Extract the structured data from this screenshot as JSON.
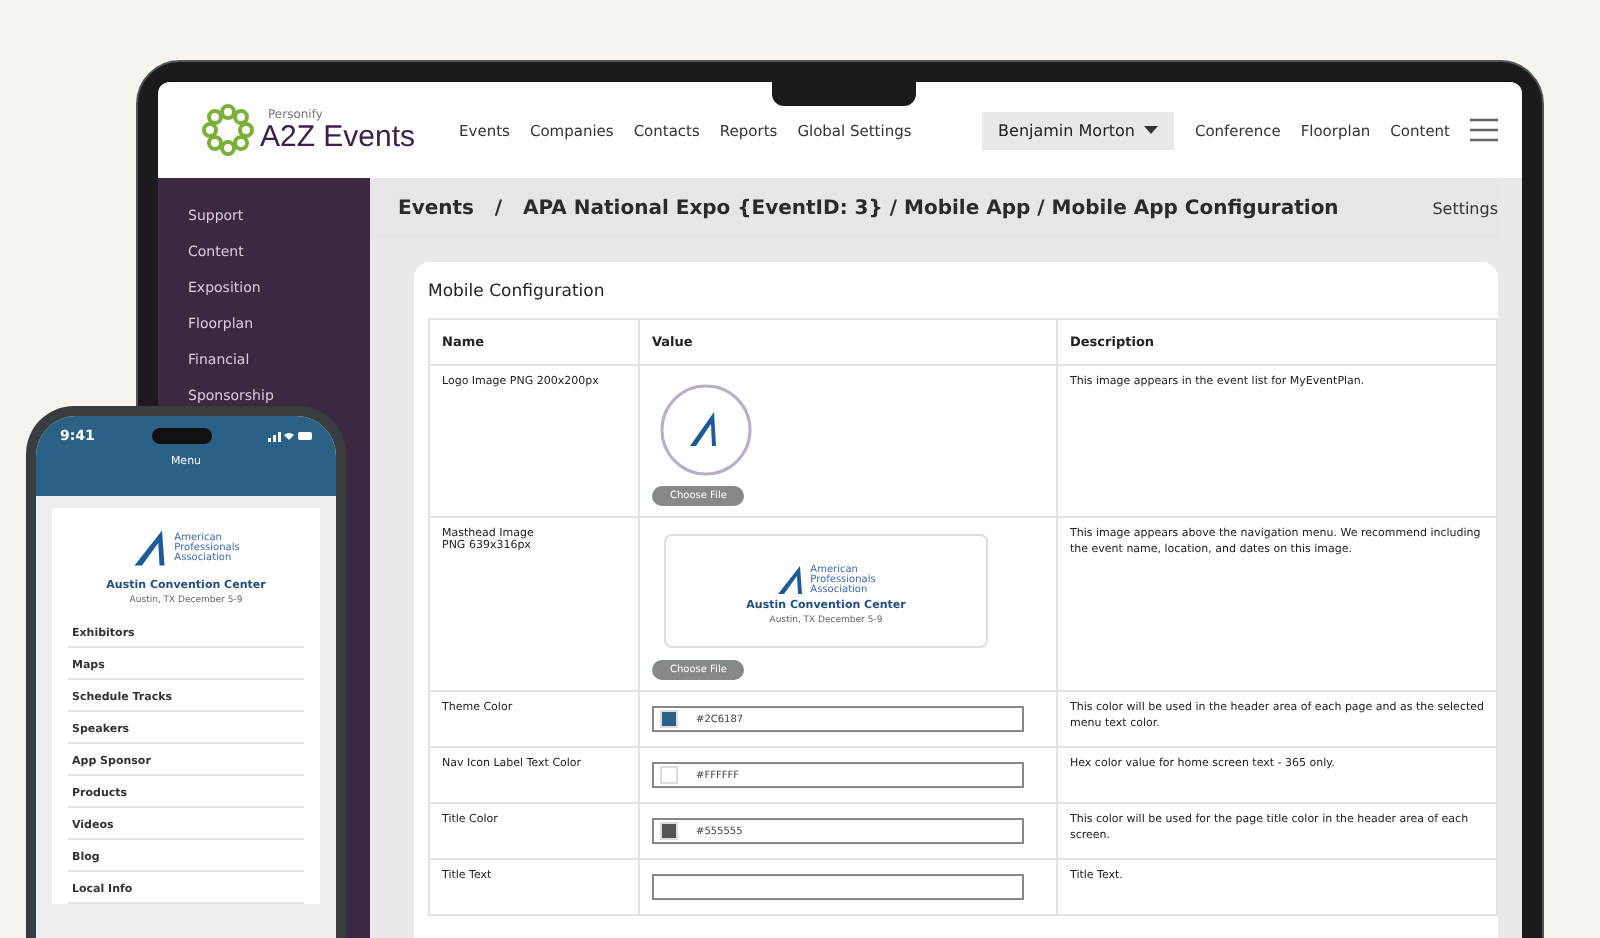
{
  "brand": {
    "small": "Personify",
    "name": "A2Z Events"
  },
  "nav": [
    "Events",
    "Companies",
    "Contacts",
    "Reports",
    "Global Settings"
  ],
  "user_menu": "Benjamin Morton",
  "nav_right": [
    "Conference",
    "Floorplan",
    "Content"
  ],
  "sidebar": {
    "items": [
      "Support",
      "Content",
      "Exposition",
      "Floorplan",
      "Financial",
      "Sponsorship"
    ]
  },
  "breadcrumb": {
    "text": "Events   /   APA National Expo {EventID: 3} / Mobile App / Mobile App Configuration",
    "action": "Settings"
  },
  "card": {
    "title": "Mobile Configuration",
    "columns": [
      "Name",
      "Value",
      "Description"
    ],
    "rows": [
      {
        "kind": "logo",
        "name": "Logo Image PNG 200x200px",
        "button": "Choose File",
        "description": "This image appears in the event list for MyEventPlan."
      },
      {
        "kind": "masthead",
        "name": "Masthead Image\nPNG 639x316px",
        "org": "American\nProfessionals\nAssociation",
        "venue": "Austin Convention Center",
        "where": "Austin, TX December 5-9",
        "button": "Choose File",
        "description": "This image appears above the navigation menu. We recommend including the event name, location, and dates on this image."
      },
      {
        "kind": "color",
        "name": "Theme Color",
        "value": "#2C6187",
        "color": "#2c6187",
        "description": "This color will be used in the header area of each page and as the selected menu text color."
      },
      {
        "kind": "color",
        "name": "Nav Icon Label Text Color",
        "value": "#FFFFFF",
        "color": "#ffffff",
        "description": "Hex color value for home screen text - 365 only."
      },
      {
        "kind": "color",
        "name": "Title Color",
        "value": "#555555",
        "color": "#555555",
        "description": "This color will be used for the page title color in the header area of each screen."
      },
      {
        "kind": "text",
        "name": "Title Text",
        "description": "Title Text."
      }
    ]
  },
  "phone": {
    "time": "9:41",
    "title": "Menu",
    "org": "American\nProfessionals\nAssociation",
    "venue": "Austin Convention Center",
    "where": "Austin, TX December 5-9",
    "menu": [
      "Exhibitors",
      "Maps",
      "Schedule Tracks",
      "Speakers",
      "App Sponsor",
      "Products",
      "Videos",
      "Blog",
      "Local Info"
    ]
  }
}
